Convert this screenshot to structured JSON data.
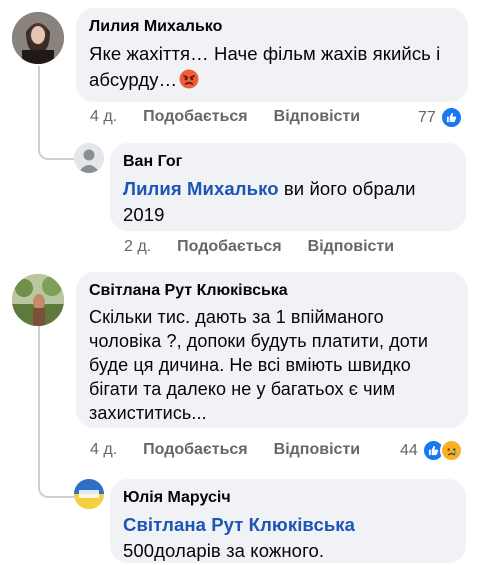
{
  "comments": [
    {
      "author": "Лилия Михалько",
      "text": "Яке жахіття… Наче фільм жахів якийсь і абсурду…",
      "time": "4 д.",
      "like": "Подобається",
      "reply": "Відповісти",
      "reaction_count": "77",
      "reactions": [
        "like-icon"
      ],
      "emoji": "angry-emoji-icon",
      "replies": [
        {
          "author": "Ван Гог",
          "mention": "Лилия Михалько",
          "text": " ви його обрали 2019",
          "time": "2 д.",
          "like": "Подобається",
          "reply": "Відповісти"
        }
      ]
    },
    {
      "author": "Світлана Рут Клюківська",
      "text": "Скільки тис. дають за 1 впійманого чоловіка ?, допоки будуть платити, доти буде ця дичина. Не всі вміють швидко бігати та далеко не у багатьох є чим захиститись...",
      "time": "4 д.",
      "like": "Подобається",
      "reply": "Відповісти",
      "reaction_count": "44",
      "reactions": [
        "like-icon",
        "sad-icon"
      ],
      "replies": [
        {
          "author": "Юлія Марусіч",
          "mention": "Світлана Рут Клюківська",
          "text": "500доларів за кожного."
        }
      ]
    }
  ],
  "colors": {
    "bubble": "#f0f2f5",
    "mention": "#1b55b5",
    "meta": "#65676b",
    "like_blue": "#1877f2",
    "sad_yellow": "#f7b125"
  }
}
